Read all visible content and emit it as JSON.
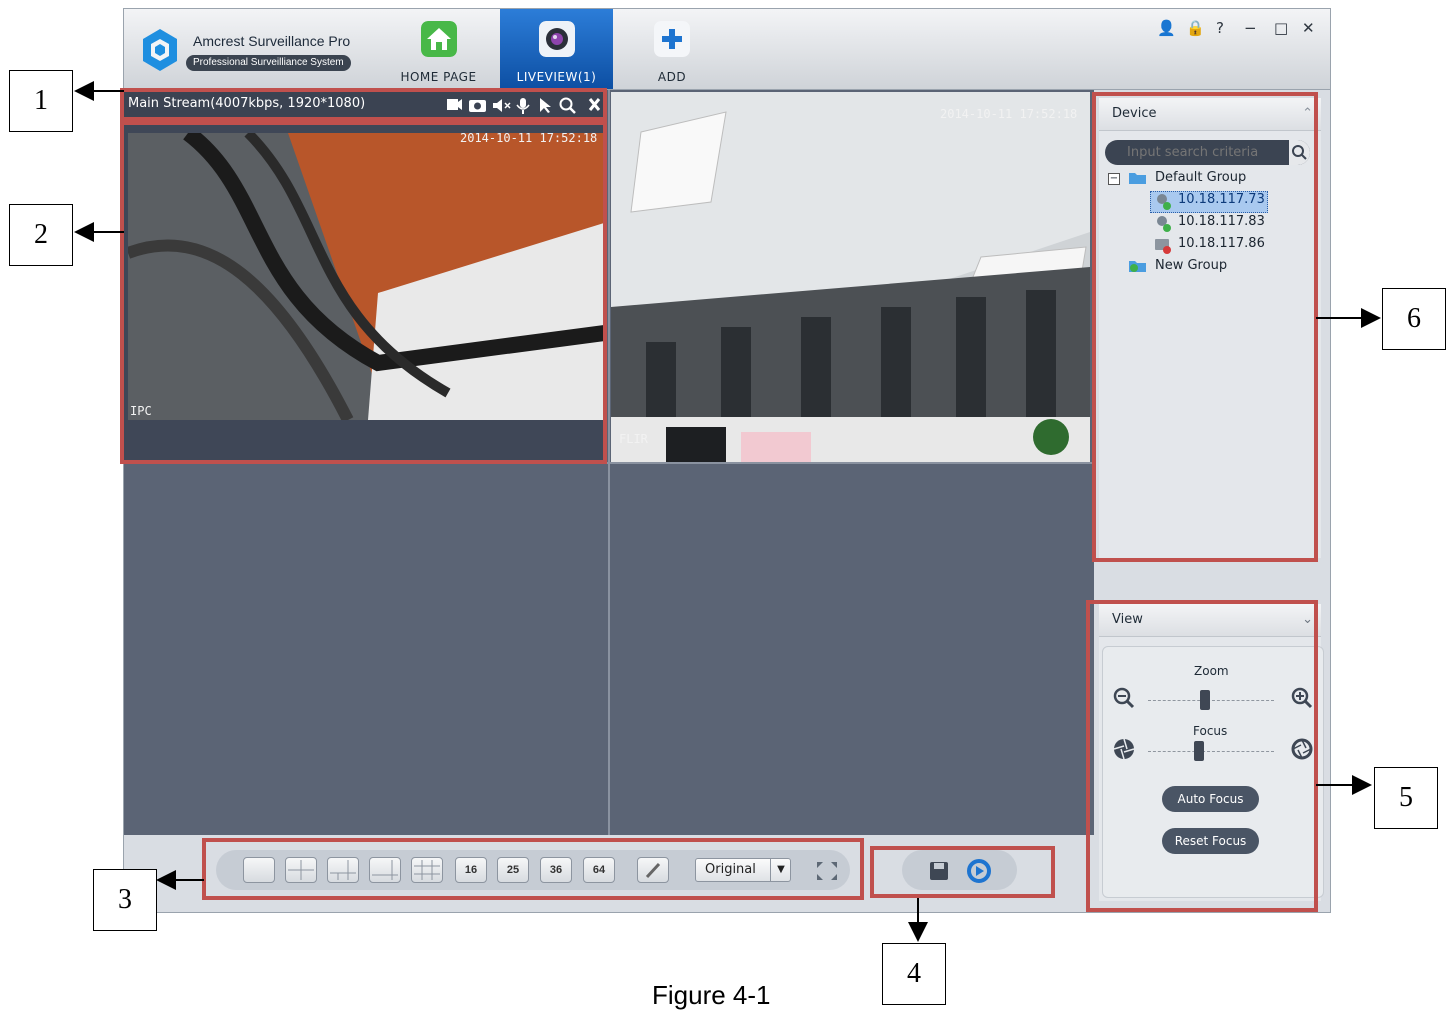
{
  "app": {
    "title": "Amcrest Surveillance Pro",
    "subtitle": "Professional Surveilliance System"
  },
  "nav": {
    "tabs": [
      {
        "label": "HOME PAGE",
        "icon": "home-icon",
        "active": false
      },
      {
        "label": "LIVEVIEW(1)",
        "icon": "camera-lens-icon",
        "active": true
      },
      {
        "label": "ADD",
        "icon": "plus-icon",
        "active": false
      }
    ]
  },
  "window_controls": {
    "user": "👤",
    "lock": "🔒",
    "help": "?",
    "minimize": "−",
    "maximize": "□",
    "close": "✕"
  },
  "stream_bar": {
    "label": "Main Stream(4007kbps, 1920*1080)"
  },
  "cameras": [
    {
      "timestamp": "2014-10-11 17:52:18",
      "overlay": "IPC"
    },
    {
      "timestamp": "2014-10-11 17:52:18",
      "overlay": "FLIR"
    }
  ],
  "bottom_bar": {
    "layouts": [
      "",
      "",
      "",
      "",
      "",
      "16",
      "25",
      "36",
      "64"
    ],
    "ratio": "Original"
  },
  "device_panel": {
    "title": "Device",
    "search_placeholder": "Input search criteria",
    "tree": {
      "group": "Default Group",
      "devices": [
        "10.18.117.73",
        "10.18.117.83",
        "10.18.117.86"
      ],
      "new_group": "New Group"
    }
  },
  "view_panel": {
    "title": "View",
    "zoom_label": "Zoom",
    "zoom_level": 0.45,
    "focus_label": "Focus",
    "focus_level": 0.4,
    "auto_focus": "Auto Focus",
    "reset_focus": "Reset Focus"
  },
  "callouts": [
    "1",
    "2",
    "3",
    "4",
    "5",
    "6"
  ],
  "caption": "Figure 4-1",
  "colors": {
    "accent": "#1565c0",
    "annotation": "#c0504d",
    "video_bg": "#5b6475"
  }
}
